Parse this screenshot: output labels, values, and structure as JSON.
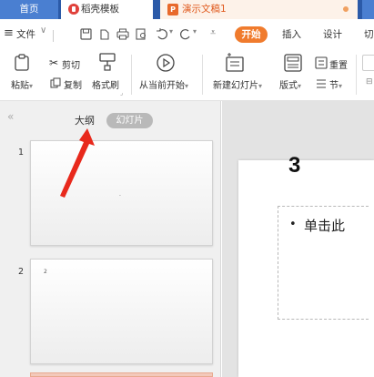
{
  "tabs": {
    "home": "首页",
    "template": "稻壳模板",
    "document": "演示文稿1"
  },
  "menu": {
    "file": "文件",
    "start": "开始",
    "insert": "插入",
    "design": "设计",
    "switch": "切"
  },
  "ribbon": {
    "paste": "粘贴",
    "cut": "剪切",
    "copy": "复制",
    "format_painter": "格式刷",
    "play_from_current": "从当前开始",
    "new_slide": "新建幻灯片",
    "layout": "版式",
    "reset": "重置",
    "section": "节"
  },
  "left_panel": {
    "outline_tab": "大纲",
    "slides_tab": "幻灯片",
    "thumbnails": [
      {
        "number": "1",
        "content": "."
      },
      {
        "number": "2",
        "content": "2"
      }
    ]
  },
  "slide": {
    "title": "3",
    "content_placeholder": "单击此"
  },
  "colors": {
    "tab_bar": "#2b5aa8",
    "start_accent": "#f07b2d",
    "annotation_arrow": "#e8291c"
  }
}
